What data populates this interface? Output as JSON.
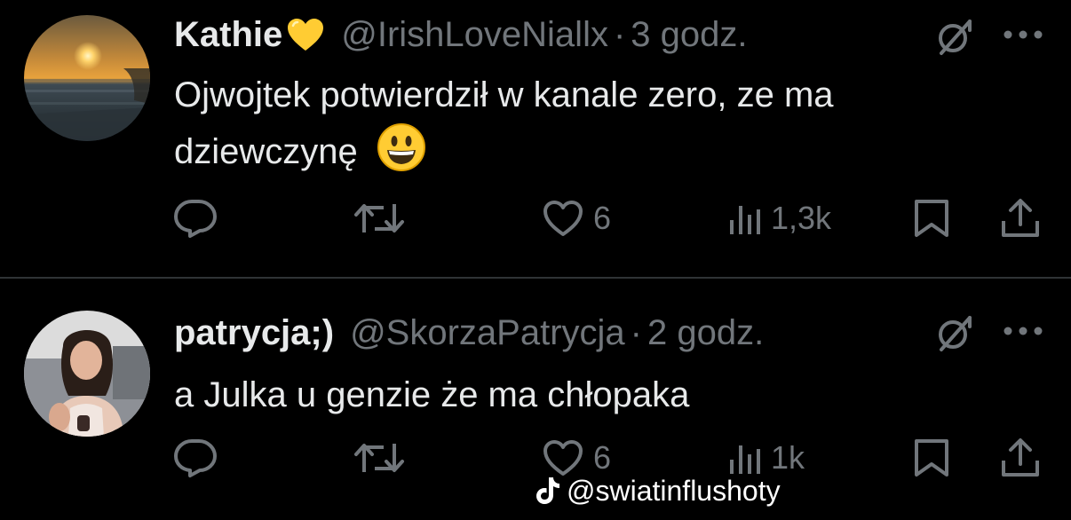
{
  "tweets": [
    {
      "display_name": "Kathie",
      "name_emoji": "yellow-heart-emoji",
      "handle": "@IrishLoveNiallx",
      "separator": "·",
      "time": "3 godz.",
      "text": "Ojwojtek potwierdził w kanale zero, ze ma dziewczynę",
      "text_emoji": "grinning-face-emoji",
      "likes": "6",
      "views": "1,3k"
    },
    {
      "display_name": "patrycja;)",
      "handle": "@SkorzaPatrycja",
      "separator": "·",
      "time": "2 godz.",
      "text": "a Julka u genzie że ma chłopaka",
      "likes": "6",
      "views": "1k"
    }
  ],
  "icons": {
    "reply": "reply-icon",
    "retweet": "retweet-icon",
    "like": "heart-icon",
    "views": "views-icon",
    "bookmark": "bookmark-icon",
    "share": "share-icon",
    "grok": "grok-icon",
    "more": "more-icon"
  },
  "watermark": {
    "text": "@swiatinflushoty",
    "icon": "tiktok-icon"
  },
  "colors": {
    "background": "#000000",
    "text": "#e7e9ea",
    "secondary": "#71767b",
    "divider": "#2f3336"
  }
}
